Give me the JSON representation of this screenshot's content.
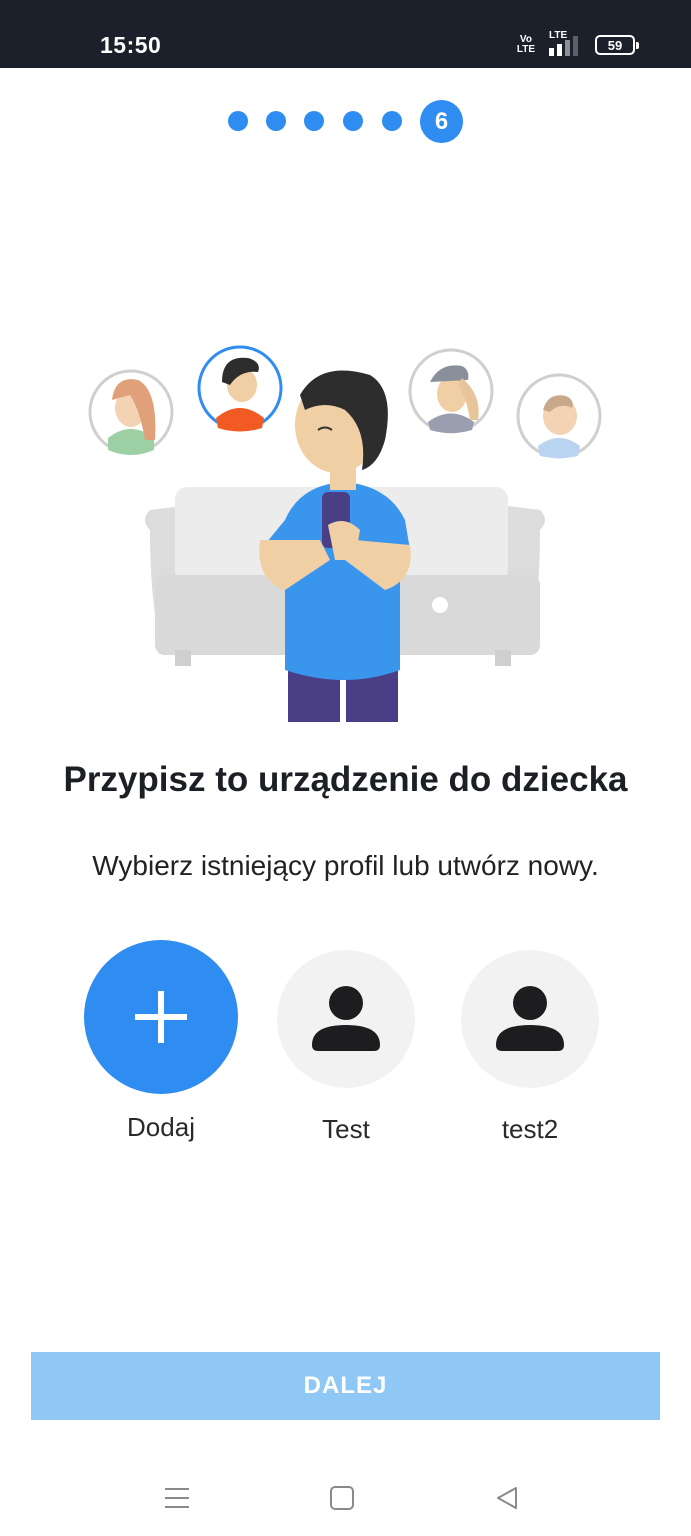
{
  "status_bar": {
    "time": "15:50",
    "volte_top": "Vo",
    "volte_bottom": "LTE",
    "network": "LTE",
    "battery": "59",
    "background_color": "#1b202a"
  },
  "stepper": {
    "total_steps": 6,
    "current_step": "6",
    "accent_color": "#2f8cf0"
  },
  "title": "Przypisz to urządzenie do dziecka",
  "subtitle": "Wybierz istniejący profil lub utwórz nowy.",
  "profiles": [
    {
      "label": "Dodaj",
      "icon": "plus-icon",
      "type": "add"
    },
    {
      "label": "Test",
      "icon": "user-icon",
      "type": "user"
    },
    {
      "label": "test2",
      "icon": "user-icon",
      "type": "user"
    }
  ],
  "next_button": {
    "label": "DALEJ",
    "enabled": false,
    "color": "#90c8f5"
  },
  "nav_bar": {
    "items": [
      "menu-icon",
      "home-icon",
      "back-icon"
    ]
  }
}
